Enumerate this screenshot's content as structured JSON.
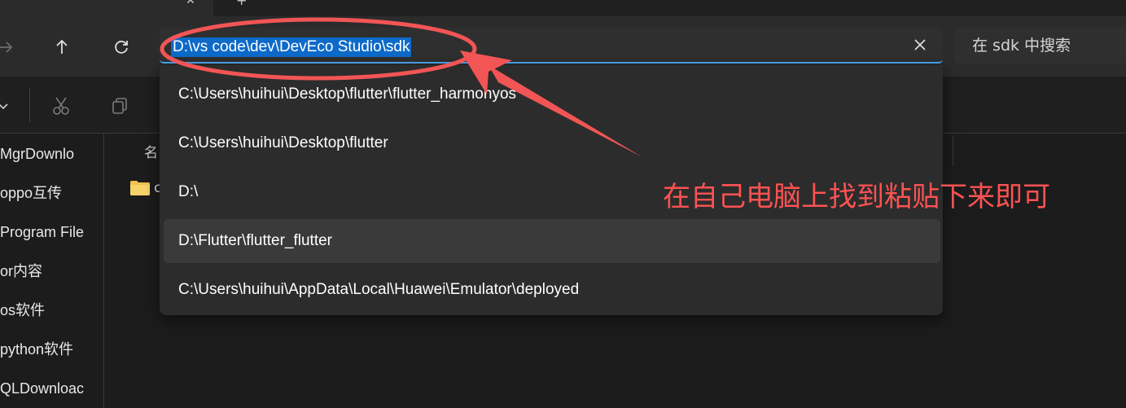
{
  "address_bar": {
    "path": "D:\\vs code\\dev\\DevEco Studio\\sdk"
  },
  "search": {
    "placeholder": "在 sdk 中搜索"
  },
  "suggestions": [
    "C:\\Users\\huihui\\Desktop\\flutter\\flutter_harmonyos",
    "C:\\Users\\huihui\\Desktop\\flutter",
    "D:\\",
    "D:\\Flutter\\flutter_flutter",
    "C:\\Users\\huihui\\AppData\\Local\\Huawei\\Emulator\\deployed"
  ],
  "sidebar": {
    "items": [
      "MgrDownlo",
      "oppo互传",
      "Program File",
      "or内容",
      "os软件",
      "python软件",
      "QLDownloac"
    ]
  },
  "content": {
    "column_header": "名",
    "folder_label": "c"
  },
  "annotation": {
    "text": "在自己电脑上找到粘贴下来即可",
    "color": "#ff5252"
  },
  "colors": {
    "accent": "#4ca8f5",
    "selection": "#0d6ac9"
  }
}
